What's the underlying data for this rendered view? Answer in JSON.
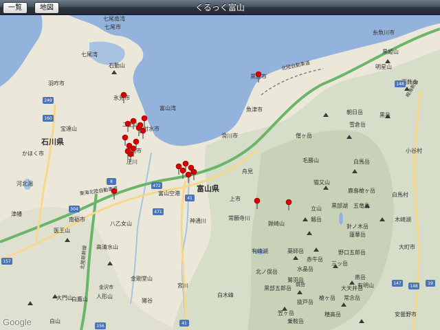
{
  "navbar": {
    "list_label": "一覧",
    "map_label": "地図",
    "title": "くるっく富山"
  },
  "map": {
    "attribution": "Google",
    "prefecture_labels": [
      "石川県",
      "富山県"
    ],
    "places": [
      "七尾南湾",
      "七尾市",
      "七尾湾",
      "石動山",
      "羽咋市",
      "氷見市",
      "富山湾",
      "宝達山",
      "かほく市",
      "津幡",
      "金沢市",
      "二上山",
      "射水市",
      "高岡市",
      "庄川",
      "河北潟",
      "南砺市",
      "医王山",
      "八乙女山",
      "高清水山",
      "大門山",
      "白山",
      "富山空港",
      "神通川",
      "常願寺川",
      "鍬崎山",
      "有峰湖",
      "北ノ俣岳",
      "黒部五郎岳",
      "薬師岳",
      "立山",
      "毛勝山",
      "黒部湖",
      "剱岳",
      "猫又山",
      "鹿島槍ヶ岳",
      "五竜岳",
      "白馬岳",
      "朝日岳",
      "雪倉岳",
      "黒岳",
      "栂海新道",
      "雨飾山",
      "黒姫山",
      "明星山",
      "糸魚川市",
      "黒部市",
      "魚津市",
      "滑川市",
      "僧ヶ岳",
      "水晶岳",
      "三ッ岳",
      "野口五郎岳",
      "針ノ木岳",
      "蓮華岳",
      "赤牛岳",
      "鷲羽岳",
      "笠ヶ岳",
      "抜戸岳",
      "槍ヶ岳",
      "穂高岳",
      "焼岳",
      "乗鞍岳",
      "常念岳",
      "燕岳",
      "有明山",
      "大天井岳",
      "安曇野市",
      "木崎湖",
      "白馬村",
      "小谷村",
      "大町市",
      "上市",
      "舟見",
      "白鷹山",
      "人形山",
      "金剛堂山",
      "猪谷",
      "宮川",
      "白木峰",
      "北陸本線",
      "北陸自動車道",
      "東海北陸自動車道",
      "北陸新幹線"
    ],
    "road_numbers": [
      "249",
      "160",
      "8",
      "304",
      "472",
      "41",
      "41",
      "157",
      "156",
      "471",
      "148",
      "147",
      "148",
      "19"
    ],
    "pin_count": 23
  },
  "colors": {
    "water": "#94b3dc",
    "land": "#ece8d9",
    "mountain": "#d6ddc8",
    "pin": "#d90000",
    "highway": "#6bb56b",
    "road": "#f7d88b"
  }
}
